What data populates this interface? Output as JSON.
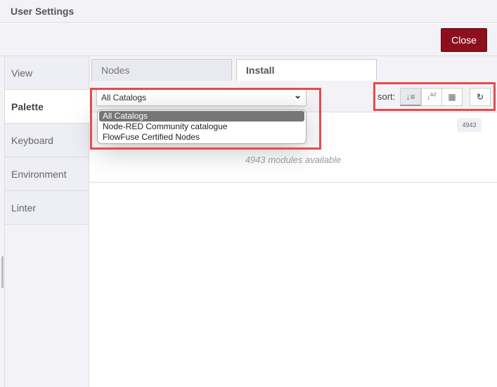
{
  "header": {
    "title": "User Settings",
    "close_label": "Close",
    "close_color": "#8c101c"
  },
  "sidebar": {
    "items": [
      {
        "label": "View"
      },
      {
        "label": "Palette",
        "active": true
      },
      {
        "label": "Keyboard"
      },
      {
        "label": "Environment"
      },
      {
        "label": "Linter"
      }
    ]
  },
  "tabs": [
    {
      "label": "Nodes"
    },
    {
      "label": "Install",
      "active": true
    }
  ],
  "catalog": {
    "selected": "All Catalogs",
    "options": [
      "All Catalogs",
      "Node-RED Community catalogue",
      "FlowFuse Certified Nodes"
    ]
  },
  "sort": {
    "label": "sort:",
    "buttons": [
      {
        "icon": "sort-relevance-icon",
        "active": true
      },
      {
        "icon": "sort-alpha-icon"
      },
      {
        "icon": "calendar-icon"
      }
    ],
    "refresh_icon": "refresh-icon"
  },
  "results": {
    "count_badge": "4943",
    "available_text": "4943 modules available"
  },
  "highlight_color": "#e84a4a"
}
